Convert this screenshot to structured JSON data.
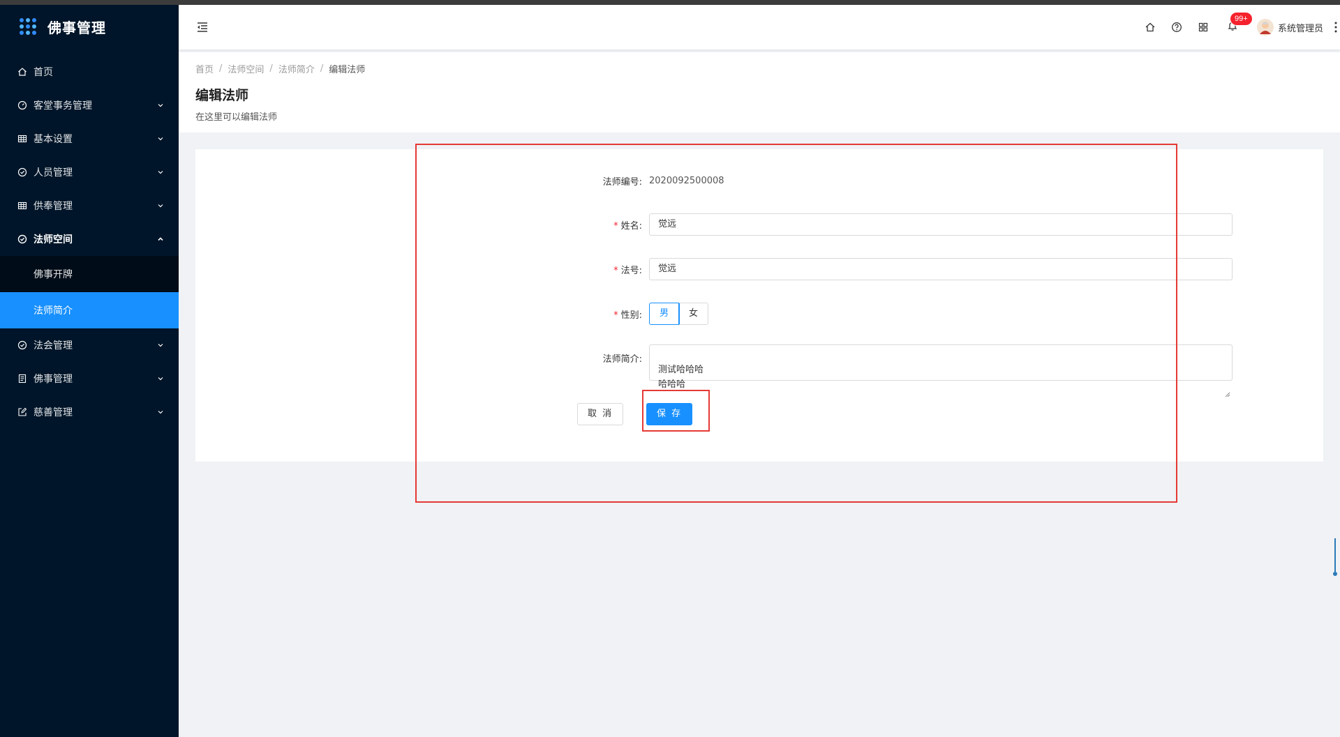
{
  "sidebar": {
    "logo_title": "佛事管理",
    "items": [
      {
        "label": "首页",
        "icon": "home-icon"
      },
      {
        "label": "客堂事务管理",
        "icon": "dashboard-icon"
      },
      {
        "label": "基本设置",
        "icon": "table-icon"
      },
      {
        "label": "人员管理",
        "icon": "check-circle-icon"
      },
      {
        "label": "供奉管理",
        "icon": "table-icon"
      },
      {
        "label": "法师空间",
        "icon": "check-circle-icon"
      },
      {
        "label": "法会管理",
        "icon": "check-circle-icon"
      },
      {
        "label": "佛事管理",
        "icon": "profile-icon"
      },
      {
        "label": "慈善管理",
        "icon": "edit-icon"
      }
    ],
    "submenu": [
      {
        "label": "佛事开牌"
      },
      {
        "label": "法师简介"
      }
    ]
  },
  "header": {
    "badge": "99+",
    "user_name": "系统管理员"
  },
  "breadcrumb": [
    "首页",
    "法师空间",
    "法师简介",
    "编辑法师"
  ],
  "page": {
    "title": "编辑法师",
    "subtitle": "在这里可以编辑法师"
  },
  "form": {
    "id_label": "法师编号:",
    "id_value": "2020092500008",
    "name_label": "姓名:",
    "name_value": "觉远",
    "dharma_label": "法号:",
    "dharma_value": "觉远",
    "gender_label": "性别:",
    "gender_options": [
      "男",
      "女"
    ],
    "gender_selected": "男",
    "intro_label": "法师简介:",
    "intro_value": "测试哈哈哈\n哈哈哈",
    "cancel_label": "取 消",
    "save_label": "保 存"
  },
  "colors": {
    "sidebar_bg": "#001529",
    "accent": "#1890ff",
    "highlight_box": "#e53935",
    "required": "#f5222d"
  }
}
